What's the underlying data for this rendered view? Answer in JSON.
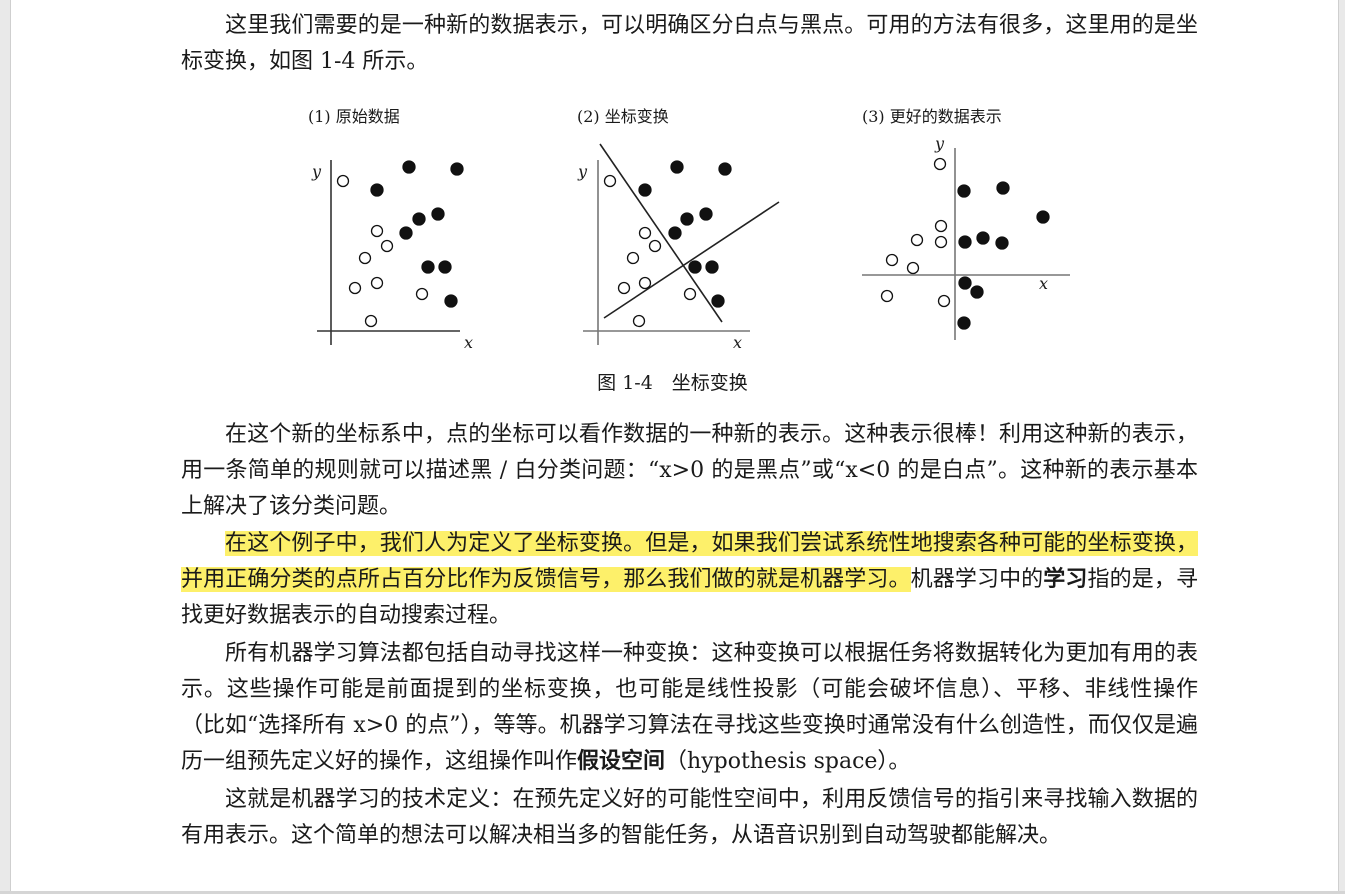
{
  "paragraphs": {
    "p1": "这里我们需要的是一种新的数据表示，可以明确区分白点与黑点。可用的方法有很多，这里用的是坐标变换，如图 1-4 所示。",
    "p2": "在这个新的坐标系中，点的坐标可以看作数据的一种新的表示。这种表示很棒！利用这种新的表示，用一条简单的规则就可以描述黑 / 白分类问题：“x>0 的是黑点”或“x<0 的是白点”。这种新的表示基本上解决了该分类问题。",
    "p3_highlight": "在这个例子中，我们人为定义了坐标变换。但是，如果我们尝试系统性地搜索各种可能的坐标变换，并用正确分类的点所占百分比作为反馈信号，那么我们做的就是机器学习。",
    "p3_rest_a": "机器学习中的",
    "p3_bold": "学习",
    "p3_rest_b": "指的是，寻找更好数据表示的自动搜索过程。",
    "p4_a": "所有机器学习算法都包括自动寻找这样一种变换：这种变换可以根据任务将数据转化为更加有用的表示。这些操作可能是前面提到的坐标变换，也可能是线性投影（可能会破坏信息）、平移、非线性操作（比如“选择所有 x>0 的点”），等等。机器学习算法在寻找这些变换时通常没有什么创造性，而仅仅是遍历一组预先定义好的操作，这组操作叫作",
    "p4_bold": "假设空间",
    "p4_b": "（hypothesis space）。",
    "p5": "这就是机器学习的技术定义：在预先定义好的可能性空间中，利用反馈信号的指引来寻找输入数据的有用表示。这个简单的想法可以解决相当多的智能任务，从语音识别到自动驾驶都能解决。"
  },
  "figure": {
    "caption": "图 1-4　坐标变换",
    "panel1_title": "(1) 原始数据",
    "panel2_title": "(2) 坐标变换",
    "panel3_title": "(3) 更好的数据表示",
    "axis_x": "x",
    "axis_y": "y"
  }
}
